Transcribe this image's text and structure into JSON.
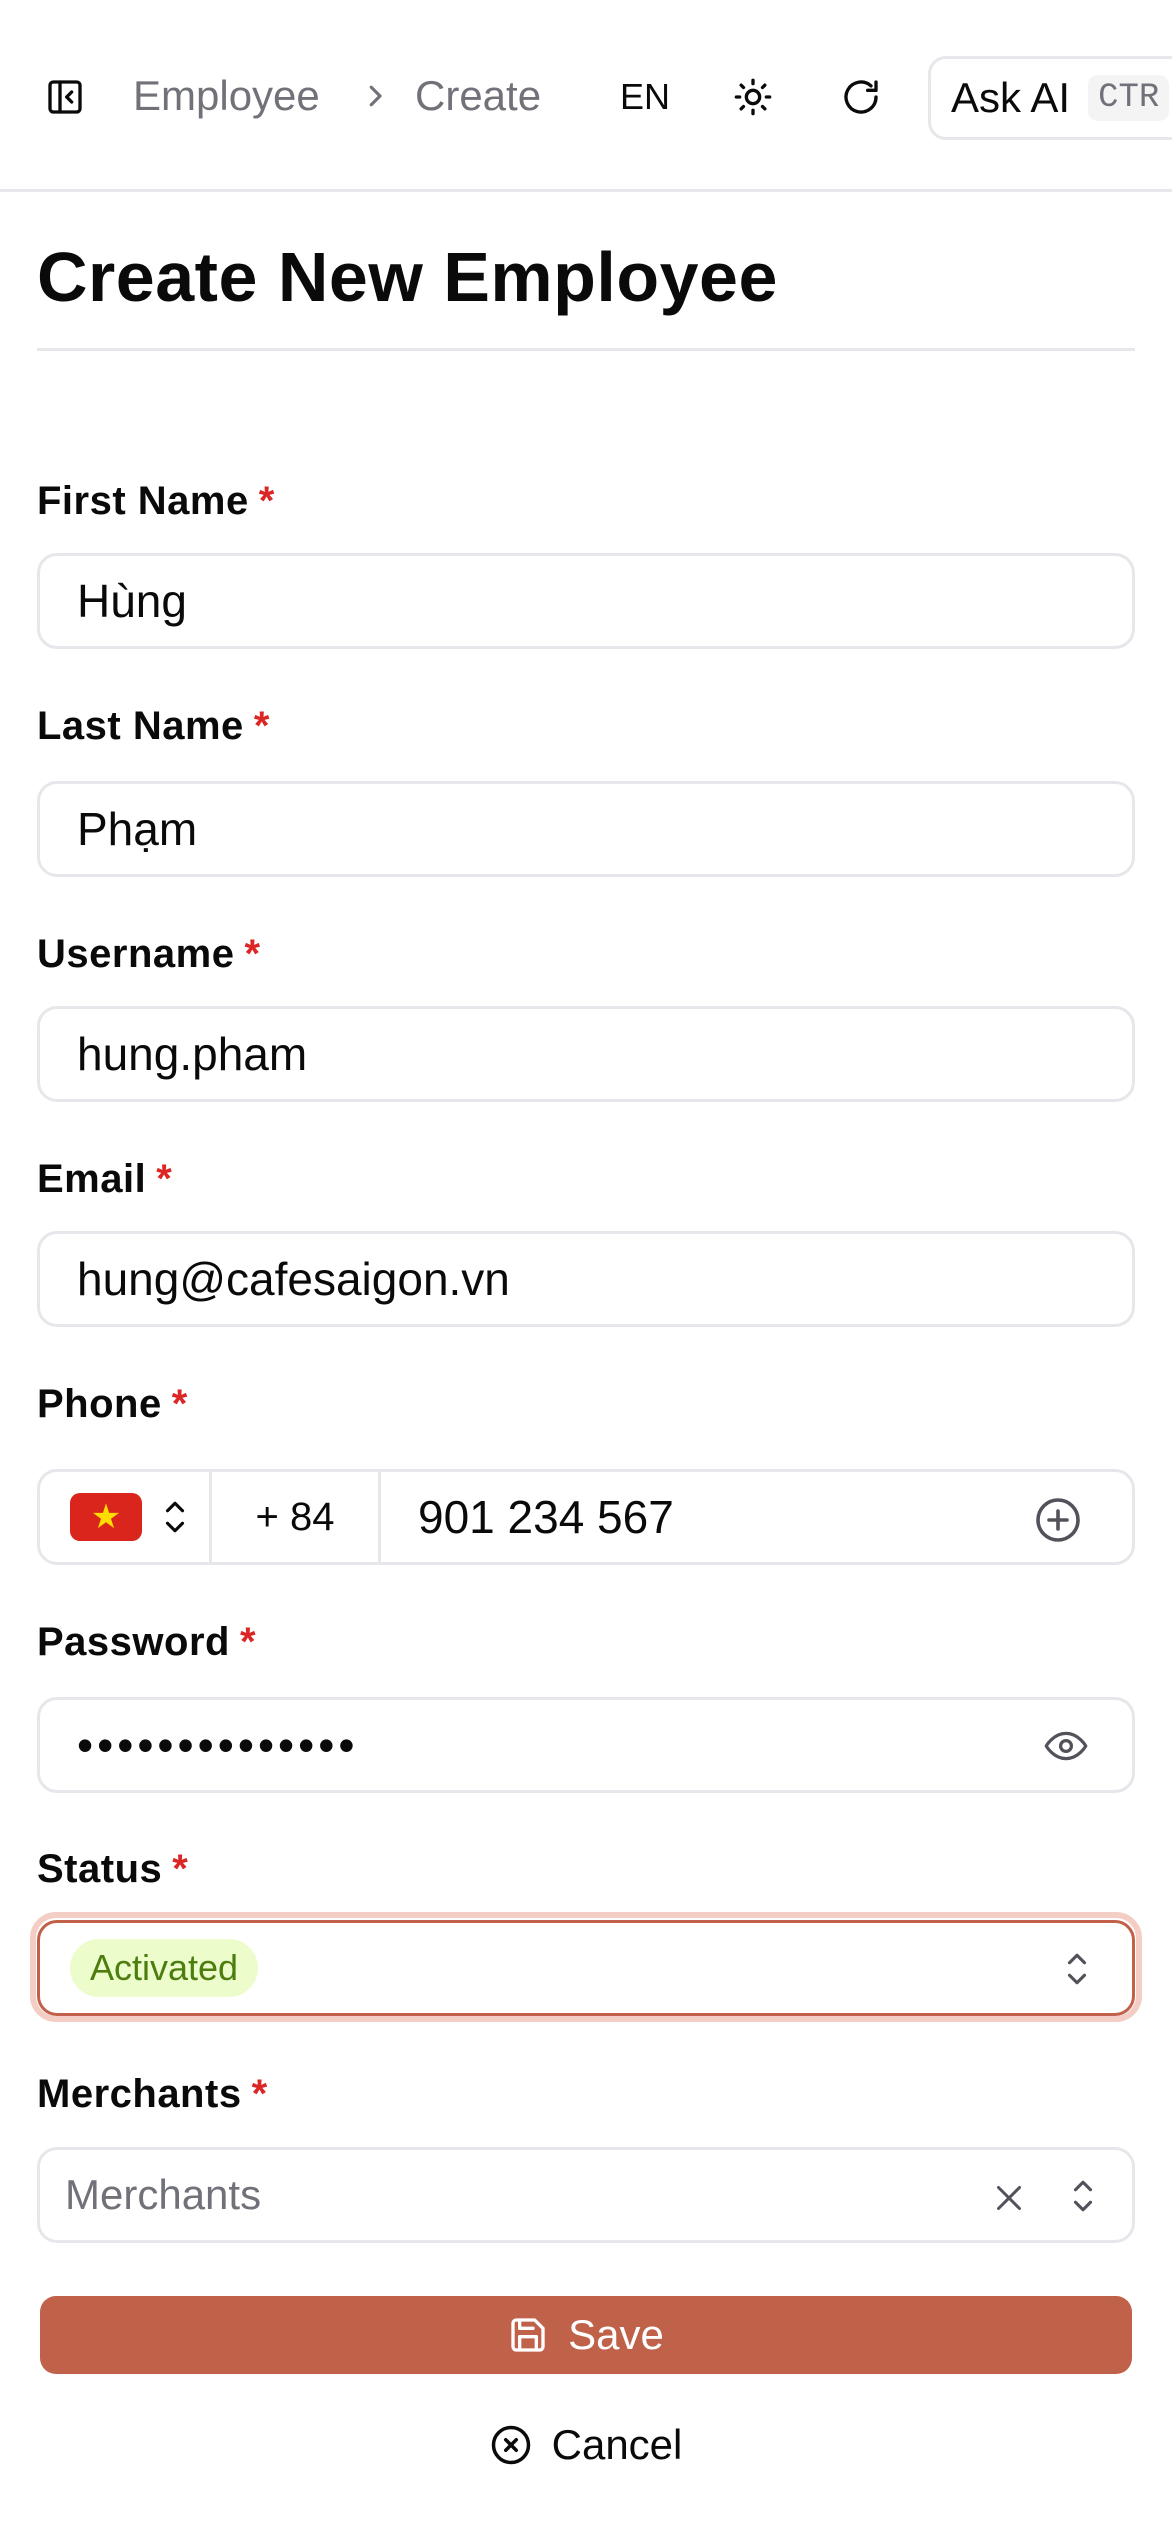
{
  "header": {
    "breadcrumb": [
      "Employee",
      "Create"
    ],
    "language": "EN",
    "ask_ai_label": "Ask AI",
    "ask_ai_shortcut": "CTR"
  },
  "page": {
    "title": "Create New Employee"
  },
  "form": {
    "first_name": {
      "label": "First Name",
      "value": "Hùng"
    },
    "last_name": {
      "label": "Last Name",
      "value": "Phạm"
    },
    "username": {
      "label": "Username",
      "value": "hung.pham"
    },
    "email": {
      "label": "Email",
      "value": "hung@cafesaigon.vn"
    },
    "phone": {
      "label": "Phone",
      "country_code": "+ 84",
      "number": "901 234 567",
      "flag": "vietnam-flag"
    },
    "password": {
      "label": "Password",
      "masked_value": "••••••••••••••"
    },
    "status": {
      "label": "Status",
      "value": "Activated"
    },
    "merchants": {
      "label": "Merchants",
      "placeholder": "Merchants"
    },
    "required_mark": "*"
  },
  "actions": {
    "save_label": "Save",
    "cancel_label": "Cancel"
  },
  "colors": {
    "accent": "#c0614a",
    "required": "#dc2626",
    "badge_bg": "#ecfccb",
    "badge_text": "#4d7c0f"
  }
}
